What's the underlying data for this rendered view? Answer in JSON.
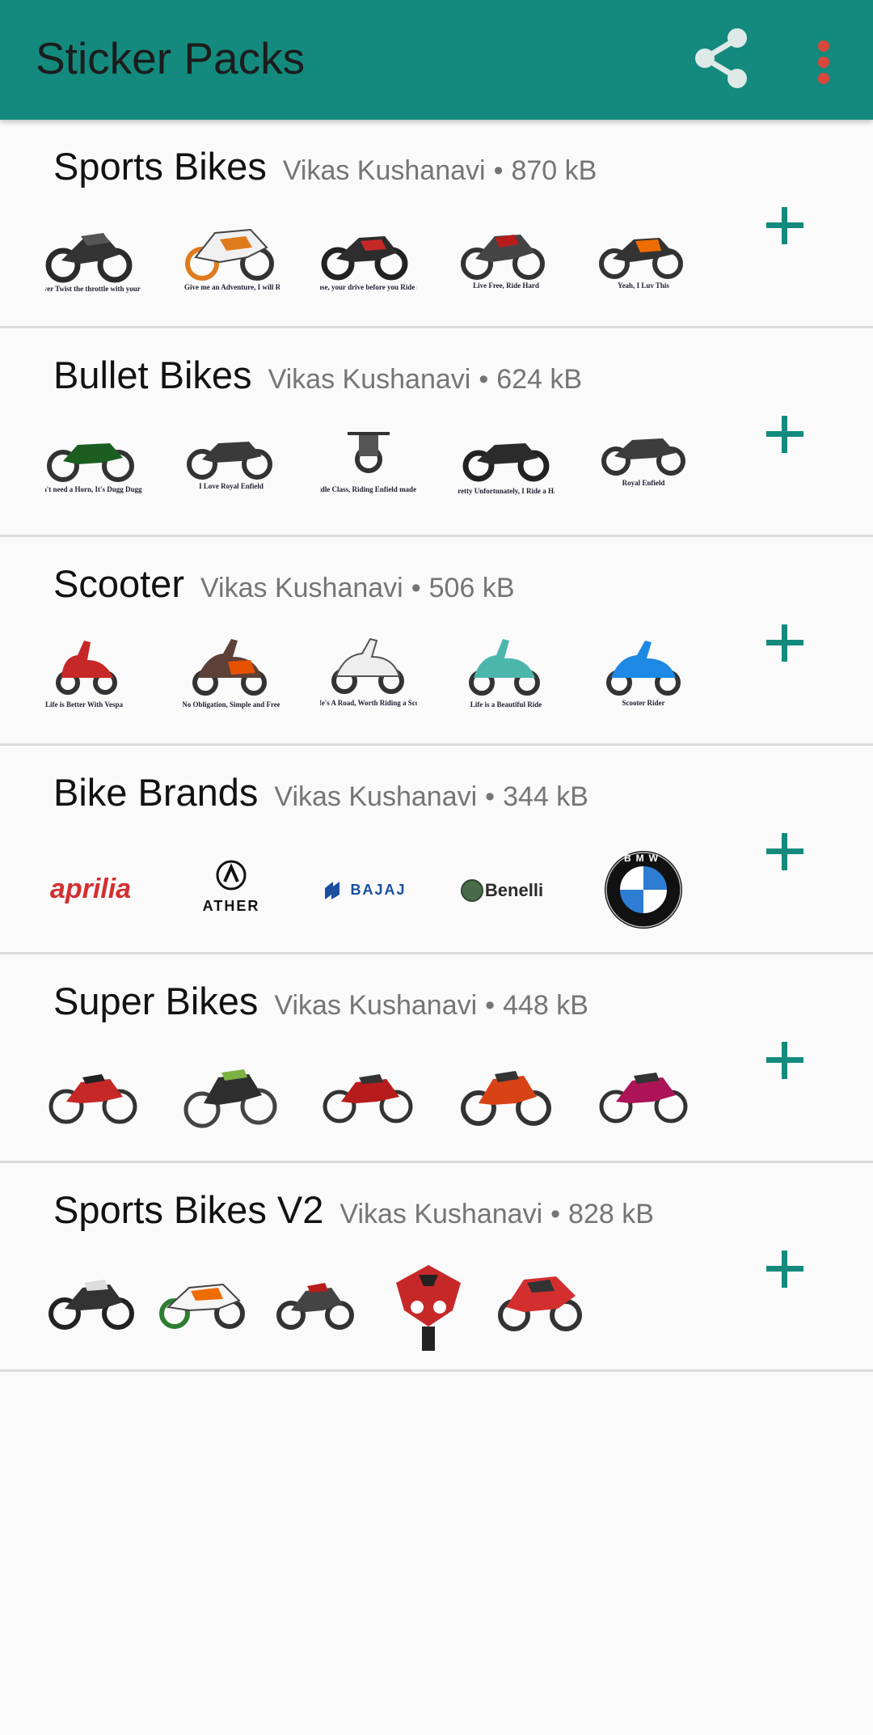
{
  "appbar": {
    "title": "Sticker Packs",
    "share_icon": "share-icon",
    "menu_icon": "overflow-menu-icon"
  },
  "colors": {
    "primary": "#138a7d",
    "menu_dots": "#d9473a",
    "text_primary": "#111111",
    "text_secondary": "#757575"
  },
  "packs": [
    {
      "name": "Sports Bikes",
      "author": "Vikas Kushanavi",
      "separator": "•",
      "size": "870 kB",
      "stickers": [
        {
          "subject": "sports-bike",
          "caption": "Never Twist the throttle with your ego"
        },
        {
          "subject": "sports-bike",
          "caption": "Sure, Give me an Adventure, I will Ride it"
        },
        {
          "subject": "sports-bike",
          "caption": "Please, your drive before you Ride safe"
        },
        {
          "subject": "sports-bike",
          "caption": "Live Free, Ride Hard"
        },
        {
          "subject": "sports-bike",
          "caption": "Yeah, I Luv This"
        }
      ]
    },
    {
      "name": "Bullet Bikes",
      "author": "Vikas Kushanavi",
      "separator": "•",
      "size": "624 kB",
      "stickers": [
        {
          "subject": "bullet-bike",
          "caption": "Bullet don't need a Horn, It's Dugg Dugg is enough"
        },
        {
          "subject": "bullet-bike",
          "caption": "I Love Royal Enfield"
        },
        {
          "subject": "bullet-bike",
          "caption": "Born in Middle Class, Riding Enfield made me ROYAL"
        },
        {
          "subject": "bullet-bike",
          "caption": "I'm a Pretty Unfortunately, I Ride a Harley...!"
        },
        {
          "subject": "bullet-bike",
          "caption": "Royal Enfield"
        }
      ]
    },
    {
      "name": "Scooter",
      "author": "Vikas Kushanavi",
      "separator": "•",
      "size": "506 kB",
      "stickers": [
        {
          "subject": "scooter",
          "caption": "Life is Better With Vespa"
        },
        {
          "subject": "scooter",
          "caption": "No Obligation, Simple and Free"
        },
        {
          "subject": "scooter",
          "caption": "Life's A Road, Worth Riding a Scoot"
        },
        {
          "subject": "scooter",
          "caption": "Life is a Beautiful Ride"
        },
        {
          "subject": "scooter",
          "caption": "Scooter Rider"
        }
      ]
    },
    {
      "name": "Bike Brands",
      "author": "Vikas Kushanavi",
      "separator": "•",
      "size": "344 kB",
      "stickers": [
        {
          "subject": "brand-logo",
          "caption": "aprilia"
        },
        {
          "subject": "brand-logo",
          "caption": "ATHER"
        },
        {
          "subject": "brand-logo",
          "caption": "BAJAJ"
        },
        {
          "subject": "brand-logo",
          "caption": "Benelli"
        },
        {
          "subject": "brand-logo",
          "caption": "BMW"
        }
      ]
    },
    {
      "name": "Super Bikes",
      "author": "Vikas Kushanavi",
      "separator": "•",
      "size": "448 kB",
      "stickers": [
        {
          "subject": "commuter-bike",
          "caption": ""
        },
        {
          "subject": "commuter-bike",
          "caption": ""
        },
        {
          "subject": "commuter-bike",
          "caption": ""
        },
        {
          "subject": "commuter-bike",
          "caption": ""
        },
        {
          "subject": "commuter-bike",
          "caption": ""
        }
      ]
    },
    {
      "name": "Sports Bikes V2",
      "author": "Vikas Kushanavi",
      "separator": "•",
      "size": "828 kB",
      "stickers": [
        {
          "subject": "sports-bike",
          "caption": ""
        },
        {
          "subject": "sports-bike",
          "caption": ""
        },
        {
          "subject": "sports-bike",
          "caption": ""
        },
        {
          "subject": "sports-bike",
          "caption": ""
        },
        {
          "subject": "sports-bike",
          "caption": ""
        }
      ]
    }
  ]
}
